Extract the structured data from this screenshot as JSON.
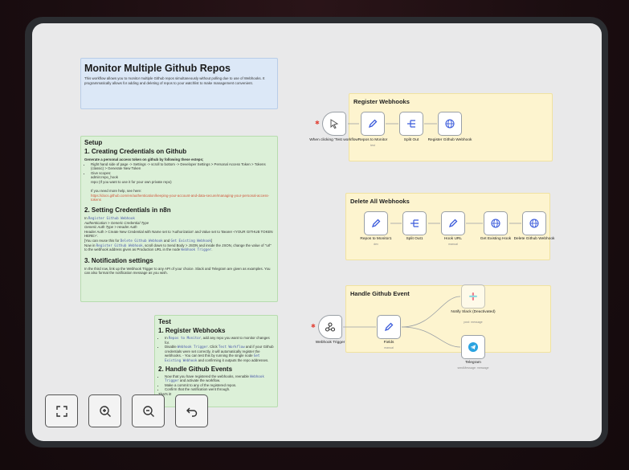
{
  "intro": {
    "title": "Monitor Multiple Github Repos",
    "body": "This workflow allows you to monitor multiple Github repos simultaneously without polling due to use of Webhooks. It programmatically allows for adding and deleting of repos to your watchlist to make management convenient."
  },
  "setup": {
    "heading": "Setup",
    "s1_title": "1. Creating Credentials on Github",
    "s1_lead": "Generate a personal access token on github by following these esteps;",
    "s1_step1": "Right hand side of page -> Settings -> scroll to bottom -> Developer Settings > Personal Access Token > Tokens (classic) > Generate New Token",
    "s1_step2": "Give scopes:",
    "s1_scope1": "admin:repo_hook",
    "s1_scope2": "repo (If you want to use it for your own private repo)",
    "s1_help": "If you need more help, see here:",
    "s1_link": "https://docs.github.com/en/authentication/keeping-your-account-and-data-secure/managing-your-personal-access-tokens",
    "s2_title": "2. Setting Credentials in n8n",
    "s2_l1a": "In ",
    "s2_l1code": "Register Github Webhook",
    "s2_l2": "Authentication > Generic Credential Type",
    "s2_l3": "Generic Auth Type > Header Auth",
    "s2_l4": "Header Auth > Create New Credential with Name set to 'Authorization' and Value set to 'Bearer <YOUR GITHUB TOKEN HERE>'.",
    "s2_l5a": "[You can reuse this for ",
    "s2_l5code1": "Delete Github Webhook",
    "s2_l5b": " and ",
    "s2_l5code2": "Get Existing Webhook",
    "s2_l5c": "]",
    "s2_l6a": "Now in ",
    "s2_l6code1": "Register Github Webhook",
    "s2_l6b": ", scroll down to Send Body > JSON and inside the JSON, change the value of \"url\" to the webhook address given as Production URL in the node ",
    "s2_l6code2": "Webhook Trigger",
    "s2_l6c": ".",
    "s3_title": "3. Notification settings",
    "s3_body": "In the third row, link up the Webhook Trigger to any API of your choice. Slack and Telegram are given as examples. You can also format the notification message as you wish."
  },
  "test": {
    "heading": "Test",
    "t1_title": "1. Register Webhooks",
    "t1_b1a": "In ",
    "t1_b1code": "Repos to Monitor",
    "t1_b1b": ", add any repo you want to monitor changes for.",
    "t1_b2a": "Disable ",
    "t1_b2code1": "Webhook Trigger",
    "t1_b2b": ". Click ",
    "t1_b2code2": "Test Workflow",
    "t1_b2c": " and if your Github credentials were set correctly, it will automatically register the webhooks. - You can test this by running the single node ",
    "t1_b2code3": "Get Existing Webhook",
    "t1_b2d": " and confirming it outputs the repo addresses.",
    "t2_title": "2. Handle Github Events",
    "t2_b1a": "Now that you have registered the webhooks, reenable ",
    "t2_b1code": "Webhook Trigger",
    "t2_b1b": " and activate the workflow.",
    "t2_b2": "Make a commit to any of the registered repos.",
    "t2_b3": "Confirm that the notification went through.",
    "t2_b4": "That's it!"
  },
  "stickies": {
    "register": "Register Webhooks",
    "delete": "Delete All Webhooks",
    "handle": "Handle Github Event"
  },
  "nodes": {
    "manual_trigger": {
      "label": "When clicking 'Test workflow'",
      "icon": "cursor-icon"
    },
    "repos_monitor": {
      "label": "Repos to Monitor",
      "sub": "test",
      "icon": "pencil-icon"
    },
    "split_out": {
      "label": "Split Out",
      "icon": "split-icon"
    },
    "register_hook": {
      "label": "Register Github Webhook",
      "icon": "globe-icon"
    },
    "repos_monitor1": {
      "label": "Repos to Monitor1",
      "sub": "dev",
      "icon": "pencil-icon"
    },
    "split_out1": {
      "label": "Split Out1",
      "icon": "split-icon"
    },
    "hook_url": {
      "label": "Hook URL",
      "sub": "manual",
      "icon": "pencil-icon"
    },
    "get_hook": {
      "label": "Get Existing Hook",
      "icon": "globe-icon"
    },
    "delete_hook": {
      "label": "Delete Github Webhook",
      "icon": "globe-icon"
    },
    "webhook_trigger": {
      "label": "Webhook Trigger",
      "icon": "webhook-icon"
    },
    "fields": {
      "label": "Fields",
      "sub": "manual",
      "icon": "pencil-icon"
    },
    "slack": {
      "label": "Notify Slack (Deactivated)",
      "sub": "post: message",
      "icon": "slack-icon"
    },
    "telegram": {
      "label": "Telegram",
      "sub": "sendMessage: message",
      "icon": "telegram-icon"
    }
  },
  "colors": {
    "accent": "#3b5bdb",
    "trigger": "#e2463b",
    "telegram": "#2aa3e0"
  }
}
